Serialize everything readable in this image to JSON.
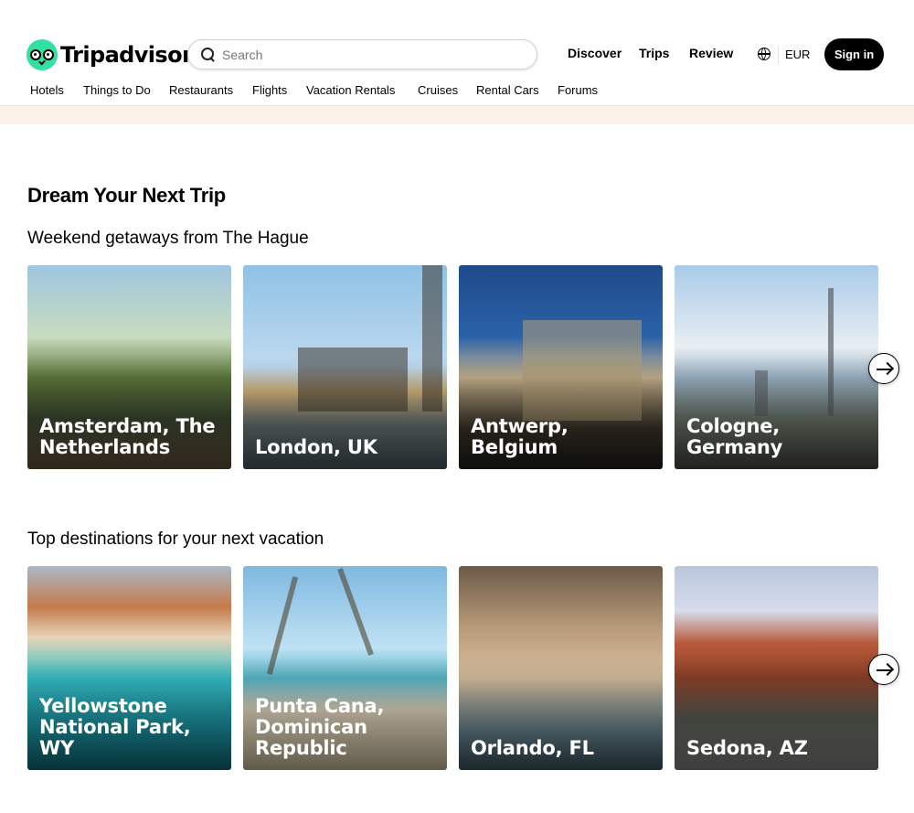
{
  "header": {
    "logo_text": "Tripadvisor",
    "search_placeholder": "Search",
    "nav": [
      "Discover",
      "Trips",
      "Review"
    ],
    "currency": "EUR",
    "signin_label": "Sign in"
  },
  "subnav": [
    "Hotels",
    "Things to Do",
    "Restaurants",
    "Flights",
    "Vacation Rentals",
    "Cruises",
    "Rental Cars",
    "Forums"
  ],
  "main": {
    "title": "Dream Your Next Trip",
    "sections": [
      {
        "heading": "Weekend getaways from The Hague",
        "cards": [
          "Amsterdam, The Netherlands",
          "London, UK",
          "Antwerp, Belgium",
          "Cologne, Germany"
        ]
      },
      {
        "heading": "Top destinations for your next vacation",
        "cards": [
          "Yellowstone National Park, WY",
          "Punta Cana, Dominican Republic",
          "Orlando, FL",
          "Sedona, AZ"
        ]
      }
    ]
  },
  "icons": {
    "logo": "owl-logo-icon",
    "search": "search-icon",
    "globe": "globe-icon",
    "next": "arrow-right-icon"
  },
  "colors": {
    "brand_green": "#34e0a1",
    "signin_bg": "#000000",
    "banner_bg": "#faf1ea"
  }
}
